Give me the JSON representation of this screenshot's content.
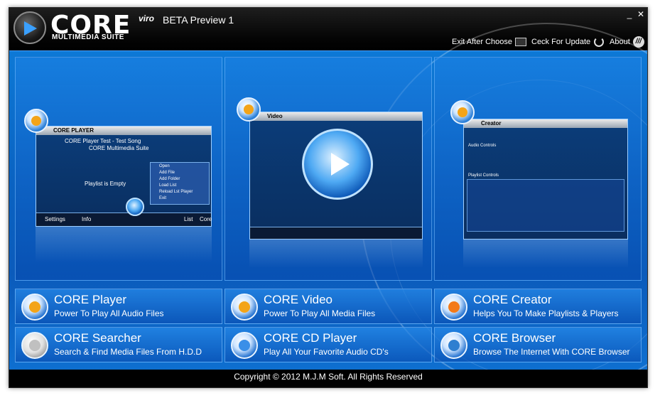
{
  "titlebar": {
    "logo_core": "CORE",
    "logo_vitro": "viro",
    "logo_beta": "BETA Preview 1",
    "logo_suite": "MULTIMEDIA SUITE",
    "minimize": "_",
    "close": "✕",
    "exit_after_choose": "Exit After Choose",
    "check_update": "Ceck For Update",
    "about": "About"
  },
  "previews": {
    "player": {
      "title": "CORE PLAYER",
      "song": "CORE Player Test - Test Song",
      "suite": "CORE Multimedia Suite",
      "playlist_empty": "Playlist is Empty",
      "menu": [
        "Open",
        "Add File",
        "Add Folder",
        "Load List",
        "Reload Lst Player",
        "Exit"
      ],
      "settings": "Settings",
      "info": "Info",
      "list": "List",
      "core": "Core"
    },
    "video": {
      "title": "Video"
    },
    "creator": {
      "title": "Creator",
      "audio_controls": "Audio Controls",
      "playlist_controls": "Playlist Controls"
    }
  },
  "tiles": [
    {
      "title": "CORE Player",
      "subtitle": "Power To Play All Audio Files",
      "accent": "#f3a419"
    },
    {
      "title": "CORE Video",
      "subtitle": "Power To Play All Media Files",
      "accent": "#f3a419"
    },
    {
      "title": "CORE Creator",
      "subtitle": "Helps You To Make Playlists & Players",
      "accent": "#f37a19"
    },
    {
      "title": "CORE Searcher",
      "subtitle": "Search & Find Media Files From H.D.D",
      "accent": "#c0c0c0"
    },
    {
      "title": "CORE CD Player",
      "subtitle": "Play All Your Favorite Audio CD's",
      "accent": "#3a8fe8"
    },
    {
      "title": "CORE Browser",
      "subtitle": "Browse The Internet With CORE Browser",
      "accent": "#2f7fd0"
    }
  ],
  "footer": {
    "copyright": "Copyright © 2012 M.J.M Soft. All Rights Reserved"
  }
}
